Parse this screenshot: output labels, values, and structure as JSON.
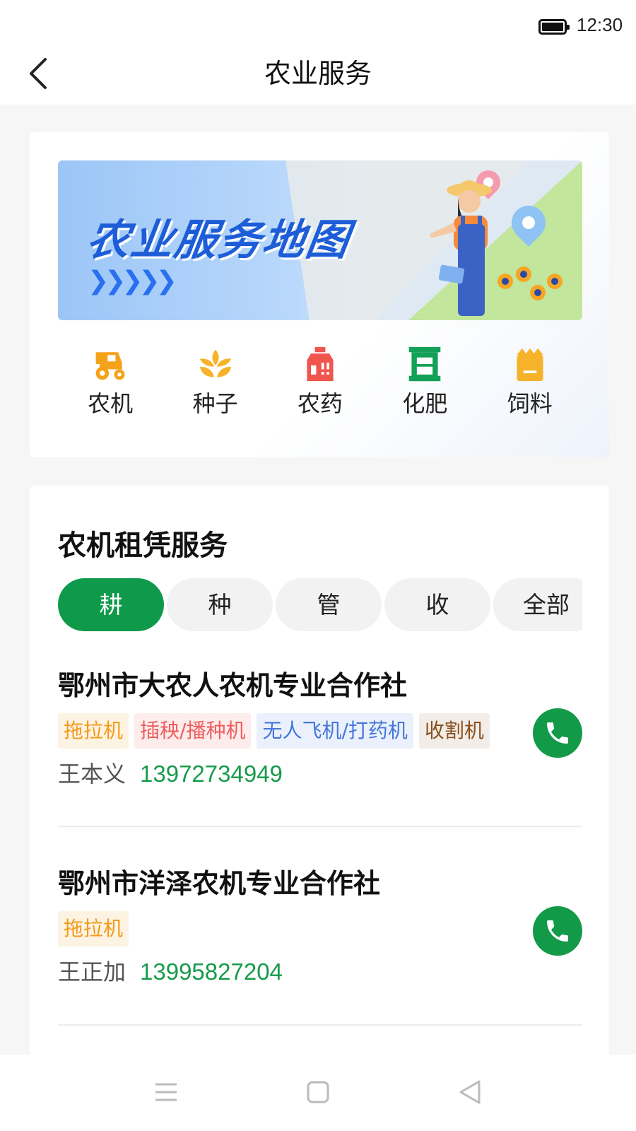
{
  "status_bar": {
    "time": "12:30",
    "battery_icon": "battery-full-icon"
  },
  "header": {
    "title": "农业服务",
    "back_icon": "back-arrow-icon"
  },
  "banner": {
    "title": "农业服务地图",
    "arrows": "❯❯❯❯❯"
  },
  "categories": [
    {
      "label": "农机",
      "icon": "tractor-icon",
      "color": "#f5a11a"
    },
    {
      "label": "种子",
      "icon": "seed-icon",
      "color": "#f6b32a"
    },
    {
      "label": "农药",
      "icon": "pesticide-icon",
      "color": "#f0554e"
    },
    {
      "label": "化肥",
      "icon": "fertilizer-icon",
      "color": "#13a057"
    },
    {
      "label": "饲料",
      "icon": "feed-icon",
      "color": "#f6b32a"
    }
  ],
  "rental": {
    "title": "农机租凭服务",
    "tabs": [
      "耕",
      "种",
      "管",
      "收",
      "全部"
    ],
    "active_tab": "耕",
    "providers": [
      {
        "name": "鄂州市大农人农机专业合作社",
        "tags": [
          "拖拉机",
          "插秧/播种机",
          "无人飞机/打药机",
          "收割机"
        ],
        "contact_name": "王本义",
        "phone": "13972734949"
      },
      {
        "name": "鄂州市洋泽农机专业合作社",
        "tags": [
          "拖拉机"
        ],
        "contact_name": "王正加",
        "phone": "13995827204"
      }
    ]
  },
  "colors": {
    "accent": "#0f9a4b",
    "phone_text": "#179b4a"
  },
  "system_nav": {
    "menu_icon": "menu-icon",
    "home_icon": "home-square-icon",
    "back_icon": "back-triangle-icon"
  }
}
